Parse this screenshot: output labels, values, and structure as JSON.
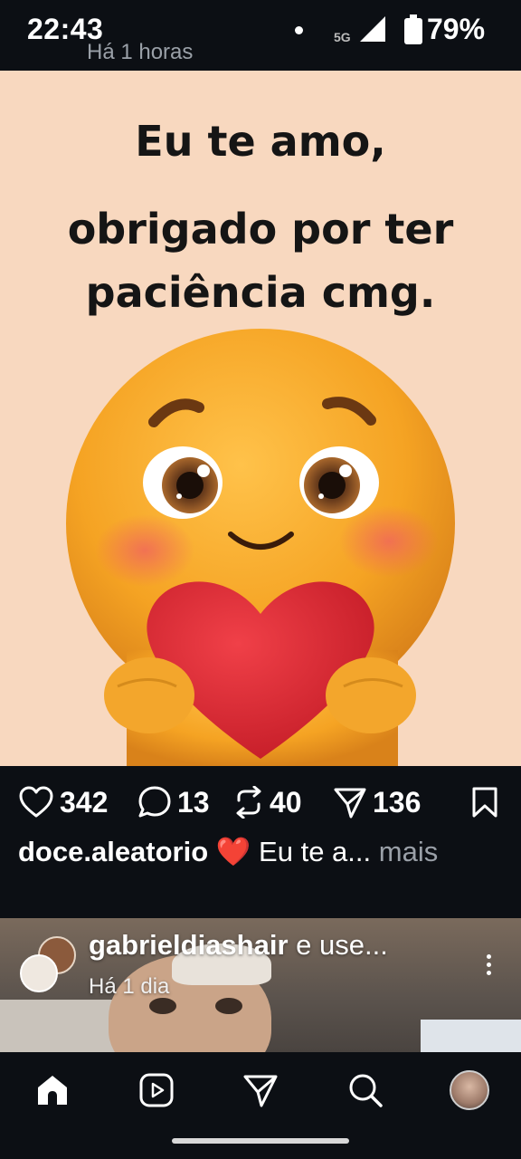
{
  "status_bar": {
    "time": "22:43",
    "network": "5G",
    "battery": "79%"
  },
  "header": {
    "cutoff_text": "Há 1 horas"
  },
  "post": {
    "image_text_line1": "Eu te amo,",
    "image_text_line2": "obrigado por ter",
    "image_text_line3": "paciência cmg.",
    "mute_icon": "speaker-muted-icon",
    "likes": "342",
    "comments": "13",
    "reposts": "40",
    "shares": "136",
    "username": "doce.aleatorio",
    "caption_emoji": "❤️",
    "caption_text": "Eu te a...",
    "more_label": "mais"
  },
  "next_post": {
    "username": "gabrieldiashair",
    "joiner": "e use...",
    "time": "Há 1 dia"
  },
  "bottom_nav": {
    "items": [
      "home-icon",
      "reels-icon",
      "direct-icon",
      "search-icon",
      "profile-avatar"
    ]
  },
  "colors": {
    "background": "#0c0f14",
    "media_bg": "#f8d8bf",
    "heart": "#e02a33",
    "emoji_fur": "#f5a623"
  }
}
